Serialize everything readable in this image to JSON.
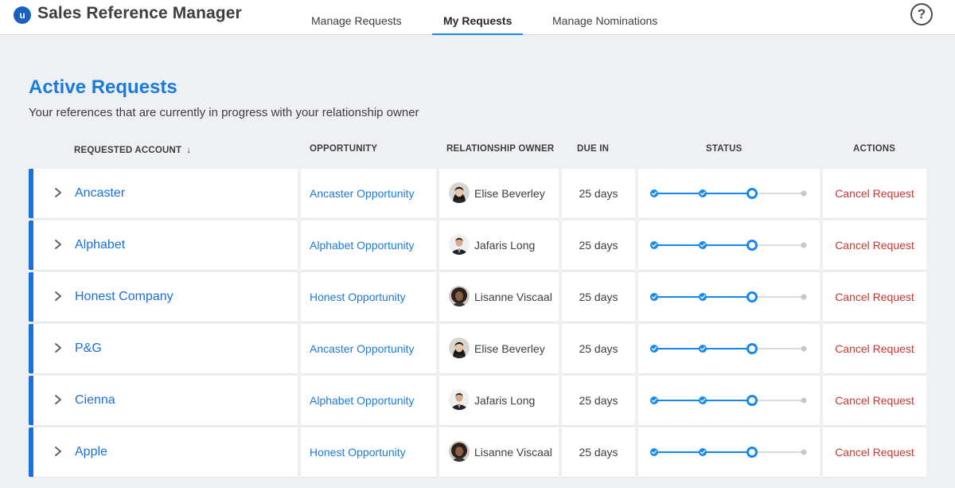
{
  "header": {
    "app_title": "Sales Reference Manager",
    "logo_letter": "u",
    "tabs": [
      {
        "label": "Manage Requests",
        "active": false
      },
      {
        "label": "My Requests",
        "active": true
      },
      {
        "label": "Manage Nominations",
        "active": false
      }
    ],
    "help_label": "?"
  },
  "section": {
    "title": "Active Requests",
    "subtitle": "Your references that are currently in progress with your relationship owner"
  },
  "columns": {
    "account": "REQUESTED ACCOUNT",
    "opportunity": "OPPORTUNITY",
    "owner": "RELATIONSHIP OWNER",
    "due": "DUE IN",
    "status": "STATUS",
    "actions": "ACTIONS"
  },
  "rows": [
    {
      "account": "Ancaster",
      "opportunity": "Ancaster Opportunity",
      "owner": "Elise Beverley",
      "avatar": "woman-dark-hair",
      "due": "25 days",
      "action": "Cancel Request",
      "status_step": 3,
      "status_steps": 4
    },
    {
      "account": "Alphabet",
      "opportunity": "Alphabet Opportunity",
      "owner": "Jafaris Long",
      "avatar": "man-suit",
      "due": "25 days",
      "action": "Cancel Request",
      "status_step": 3,
      "status_steps": 4
    },
    {
      "account": "Honest Company",
      "opportunity": "Honest Opportunity",
      "owner": "Lisanne Viscaal",
      "avatar": "woman-curly-hair",
      "due": "25 days",
      "action": "Cancel Request",
      "status_step": 3,
      "status_steps": 4
    },
    {
      "account": "P&G",
      "opportunity": "Ancaster Opportunity",
      "owner": "Elise Beverley",
      "avatar": "woman-dark-hair",
      "due": "25 days",
      "action": "Cancel Request",
      "status_step": 3,
      "status_steps": 4
    },
    {
      "account": "Cienna",
      "opportunity": "Alphabet Opportunity",
      "owner": "Jafaris Long",
      "avatar": "man-suit",
      "due": "25 days",
      "action": "Cancel Request",
      "status_step": 3,
      "status_steps": 4
    },
    {
      "account": "Apple",
      "opportunity": "Honest Opportunity",
      "owner": "Lisanne Viscaal",
      "avatar": "woman-curly-hair",
      "due": "25 days",
      "action": "Cancel Request",
      "status_step": 3,
      "status_steps": 4
    }
  ],
  "colors": {
    "brand_blue": "#1b6fd8",
    "link_blue": "#1b7bd8",
    "progress_blue": "#1589ee",
    "cancel_red": "#c23934",
    "pending_grey": "#c9c7c5"
  }
}
